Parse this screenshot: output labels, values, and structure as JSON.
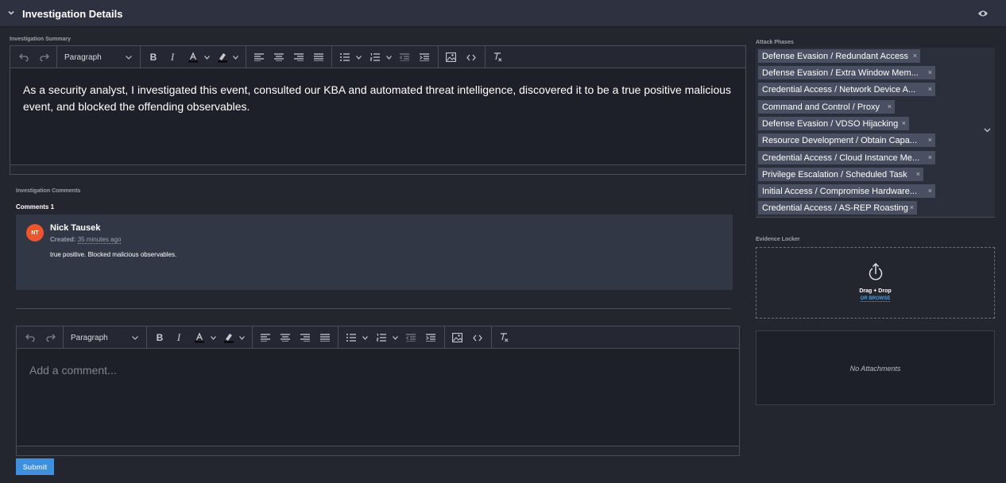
{
  "header": {
    "title": "Investigation Details"
  },
  "summary": {
    "label": "Investigation Summary",
    "text": "As a security analyst, I investigated this event, consulted our KBA and automated threat intelligence, discovered it to be a true positive malicious event, and blocked the offending observables."
  },
  "toolbar": {
    "block_format": "Paragraph"
  },
  "comments": {
    "section_label": "Investigation Comments",
    "count_label": "Comments 1",
    "items": [
      {
        "initials": "NT",
        "author": "Nick Tausek",
        "created_label": "Created:",
        "created_time": "35 minutes ago",
        "body": "true positive.  Blocked malicious observables."
      }
    ],
    "new_comment_placeholder": "Add a comment...",
    "submit_label": "Submit"
  },
  "attack_phases": {
    "label": "Attack Phases",
    "items": [
      "Defense Evasion / Redundant Access",
      "Defense Evasion / Extra Window Mem...",
      "Credential Access / Network Device A...",
      "Command and Control / Proxy",
      "Defense Evasion / VDSO Hijacking",
      "Resource Development / Obtain Capa...",
      "Credential Access / Cloud Instance Me...",
      "Privilege Escalation / Scheduled Task",
      "Initial Access / Compromise Hardware...",
      "Credential Access / AS-REP Roasting"
    ],
    "remove_glyph": "×"
  },
  "evidence_locker": {
    "label": "Evidence Locker",
    "drag_drop": "Drag + Drop",
    "browse": "OR BROWSE",
    "no_attachments": "No Attachments"
  },
  "colors": {
    "accent": "#3d8fe0",
    "avatar": "#f0542a",
    "chip": "#4a5061"
  }
}
